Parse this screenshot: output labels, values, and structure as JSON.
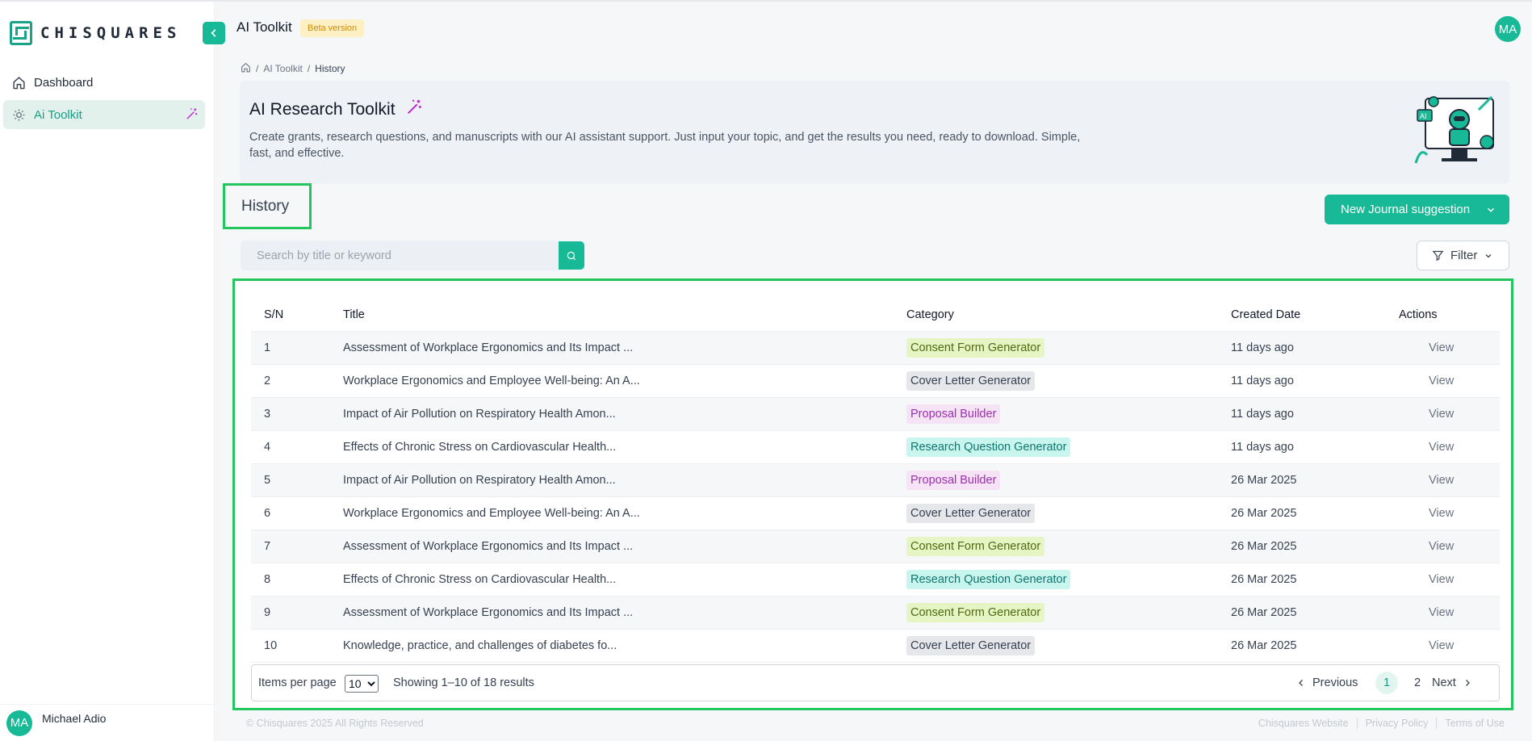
{
  "brand": {
    "name": "CHISQUARES"
  },
  "sidebar": {
    "items": [
      {
        "label": "Dashboard",
        "icon": "home-icon"
      },
      {
        "label": "Ai Toolkit",
        "icon": "gear-icon",
        "active": true
      }
    ],
    "user": {
      "initials": "MA",
      "name": "Michael Adio"
    }
  },
  "header": {
    "title": "AI Toolkit",
    "badge": "Beta version",
    "avatar_initials": "MA"
  },
  "breadcrumb": {
    "sep1": "/",
    "item1": "AI Toolkit",
    "sep2": "/",
    "current": "History"
  },
  "hero": {
    "title": "AI Research Toolkit",
    "description": "Create grants, research questions, and manuscripts with our AI assistant support. Just input your topic, and get the results you need, ready to download. Simple, fast, and effective.",
    "art_label": "AI"
  },
  "history": {
    "title": "History",
    "new_button": "New Journal suggestion",
    "search_placeholder": "Search by title or keyword",
    "filter_label": "Filter"
  },
  "colors": {
    "accent": "#17b996",
    "highlight": "#22c55e"
  },
  "table": {
    "headers": {
      "sn": "S/N",
      "title": "Title",
      "category": "Category",
      "date": "Created Date",
      "actions": "Actions"
    },
    "rows": [
      {
        "sn": "1",
        "title": "Assessment of Workplace Ergonomics and Its Impact ...",
        "category": "Consent Form Generator",
        "date": "11 days ago",
        "action": "View"
      },
      {
        "sn": "2",
        "title": "Workplace Ergonomics and Employee Well-being: An A...",
        "category": "Cover Letter Generator",
        "date": "11 days ago",
        "action": "View"
      },
      {
        "sn": "3",
        "title": "Impact of Air Pollution on Respiratory Health Amon...",
        "category": "Proposal Builder",
        "date": "11 days ago",
        "action": "View"
      },
      {
        "sn": "4",
        "title": "Effects of Chronic Stress on Cardiovascular Health...",
        "category": "Research Question Generator",
        "date": "11 days ago",
        "action": "View"
      },
      {
        "sn": "5",
        "title": "Impact of Air Pollution on Respiratory Health Amon...",
        "category": "Proposal Builder",
        "date": "26 Mar 2025",
        "action": "View"
      },
      {
        "sn": "6",
        "title": "Workplace Ergonomics and Employee Well-being: An A...",
        "category": "Cover Letter Generator",
        "date": "26 Mar 2025",
        "action": "View"
      },
      {
        "sn": "7",
        "title": "Assessment of Workplace Ergonomics and Its Impact ...",
        "category": "Consent Form Generator",
        "date": "26 Mar 2025",
        "action": "View"
      },
      {
        "sn": "8",
        "title": "Effects of Chronic Stress on Cardiovascular Health...",
        "category": "Research Question Generator",
        "date": "26 Mar 2025",
        "action": "View"
      },
      {
        "sn": "9",
        "title": "Assessment of Workplace Ergonomics and Its Impact ...",
        "category": "Consent Form Generator",
        "date": "26 Mar 2025",
        "action": "View"
      },
      {
        "sn": "10",
        "title": "Knowledge, practice, and challenges of diabetes fo...",
        "category": "Cover Letter Generator",
        "date": "26 Mar 2025",
        "action": "View"
      }
    ],
    "category_colors": {
      "Consent Form Generator": {
        "bg": "#e6f5c4",
        "fg": "#4d6b0f"
      },
      "Cover Letter Generator": {
        "bg": "#e5e7eb",
        "fg": "#374151"
      },
      "Proposal Builder": {
        "bg": "#f6e3f6",
        "fg": "#9b2fae"
      },
      "Research Question Generator": {
        "bg": "#c9f5ef",
        "fg": "#0f766e"
      }
    }
  },
  "pagination": {
    "items_label": "Items per page",
    "per_page": "10",
    "showing": "Showing 1–10 of 18 results",
    "prev": "Previous",
    "pages": [
      "1",
      "2"
    ],
    "current": "1",
    "next": "Next"
  },
  "footer": {
    "copyright": "© Chisquares 2025 All Rights Reserved",
    "links": [
      "Chisquares Website",
      "Privacy Policy",
      "Terms of Use"
    ]
  }
}
